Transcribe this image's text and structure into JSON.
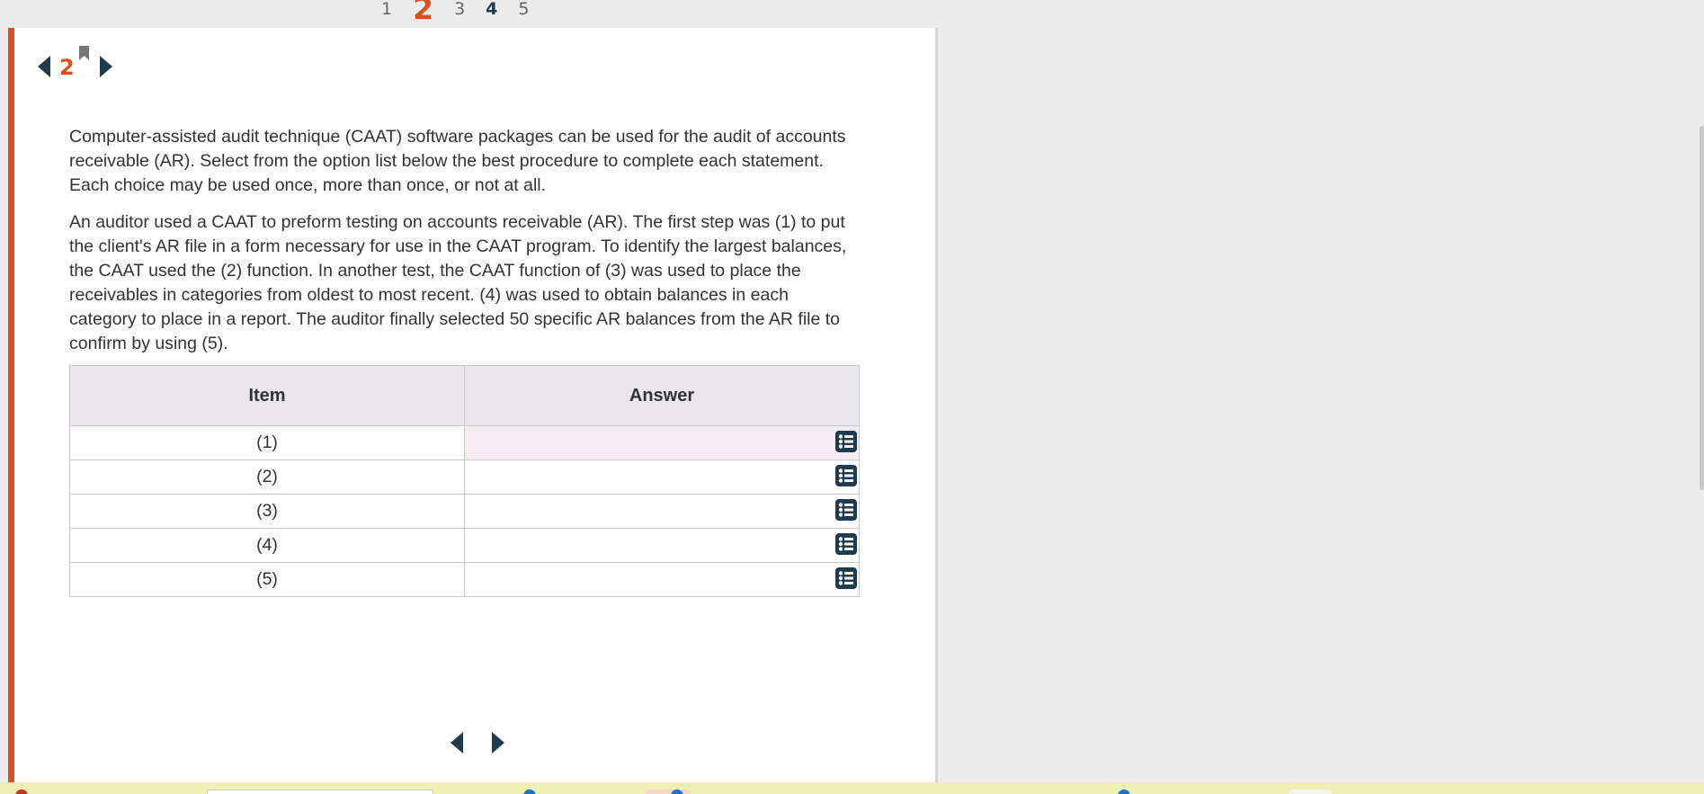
{
  "pagination": {
    "pages": [
      {
        "label": "1",
        "state": "normal"
      },
      {
        "label": "2",
        "state": "current"
      },
      {
        "label": "3",
        "state": "normal"
      },
      {
        "label": "4",
        "state": "bold"
      },
      {
        "label": "5",
        "state": "normal"
      }
    ]
  },
  "question": {
    "number": "2",
    "paragraphs": [
      "Computer-assisted audit technique (CAAT) software packages can be used for the audit of accounts receivable (AR). Select from the option list below the best procedure to complete each statement. Each choice may be used once, more than once, or not at all.",
      "An auditor used a CAAT to preform testing on accounts receivable (AR). The first step was (1) to put the client's AR file in a form necessary for use in the CAAT program. To identify the largest balances, the CAAT used the (2) function. In another test, the CAAT function of (3) was used to place the receivables in categories from oldest to most recent. (4) was used to obtain balances in each category to place in a report. The auditor finally selected 50 specific AR balances from the AR file to confirm by using (5)."
    ]
  },
  "table": {
    "headers": {
      "item": "Item",
      "answer": "Answer"
    },
    "rows": [
      {
        "item": "(1)",
        "answer": ""
      },
      {
        "item": "(2)",
        "answer": ""
      },
      {
        "item": "(3)",
        "answer": ""
      },
      {
        "item": "(4)",
        "answer": ""
      },
      {
        "item": "(5)",
        "answer": ""
      }
    ]
  },
  "colors": {
    "accent": "#d9501e",
    "nav": "#1f3b4d",
    "header_bg": "#e9e6ec",
    "selected_bg": "#f4eef2"
  }
}
